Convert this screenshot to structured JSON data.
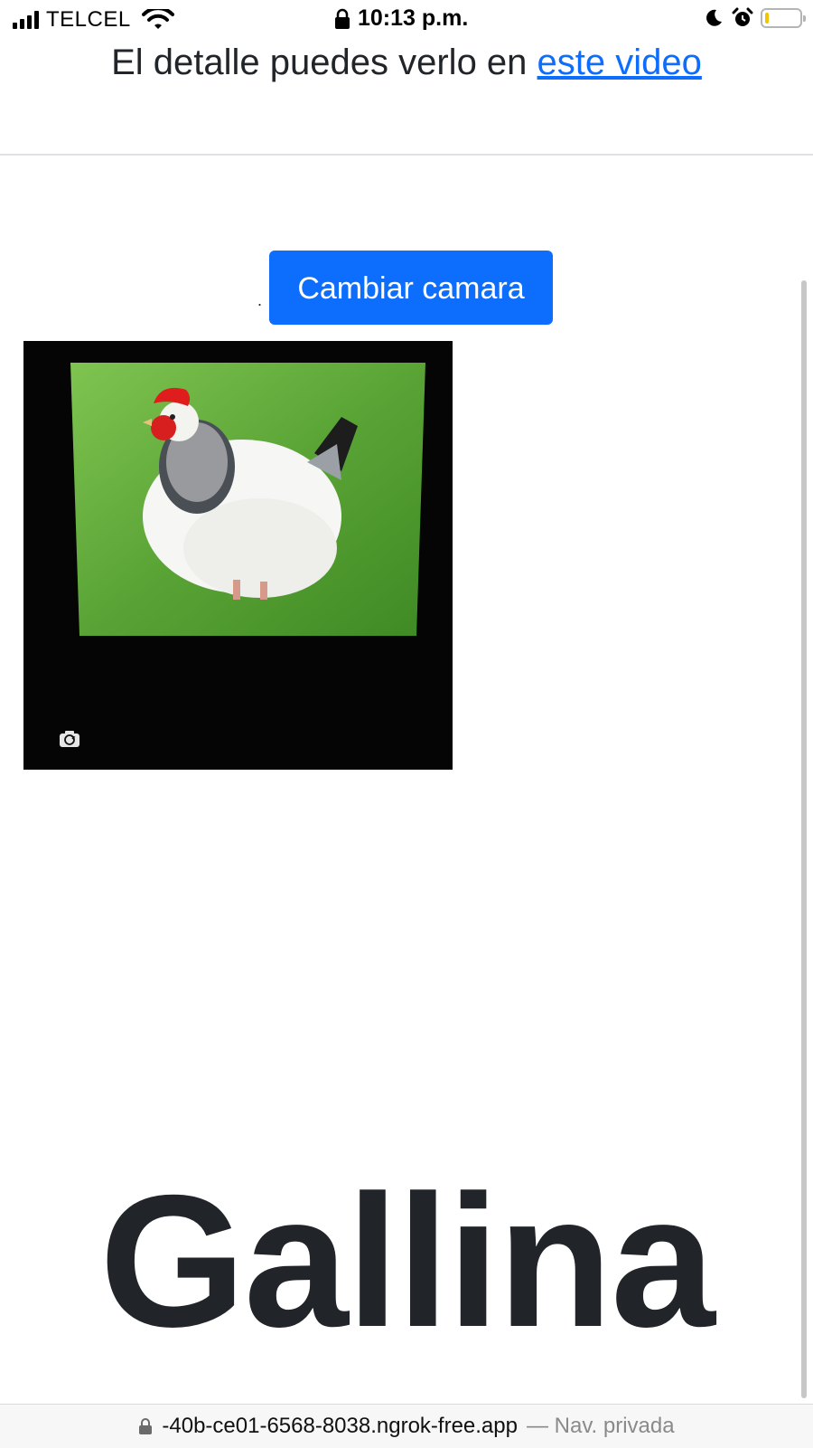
{
  "status_bar": {
    "carrier": "TELCEL",
    "time": "10:13 p.m.",
    "battery_level": 0.1,
    "colors": {
      "battery_fill": "#f2c500"
    }
  },
  "intro": {
    "text": "El detalle puedes verlo en ",
    "link_text": "este video"
  },
  "controls": {
    "dot": ".",
    "switch_camera_label": "Cambiar camara"
  },
  "camera": {
    "subject": "chicken on grass",
    "switch_icon": "camera-switch-icon"
  },
  "prediction": {
    "label": "Gallina"
  },
  "address_bar": {
    "url": "-40b-ce01-6568-8038.ngrok-free.app",
    "mode": "— Nav. privada"
  },
  "colors": {
    "primary": "#0d6efd",
    "text": "#212529",
    "link": "#0d6efd"
  }
}
